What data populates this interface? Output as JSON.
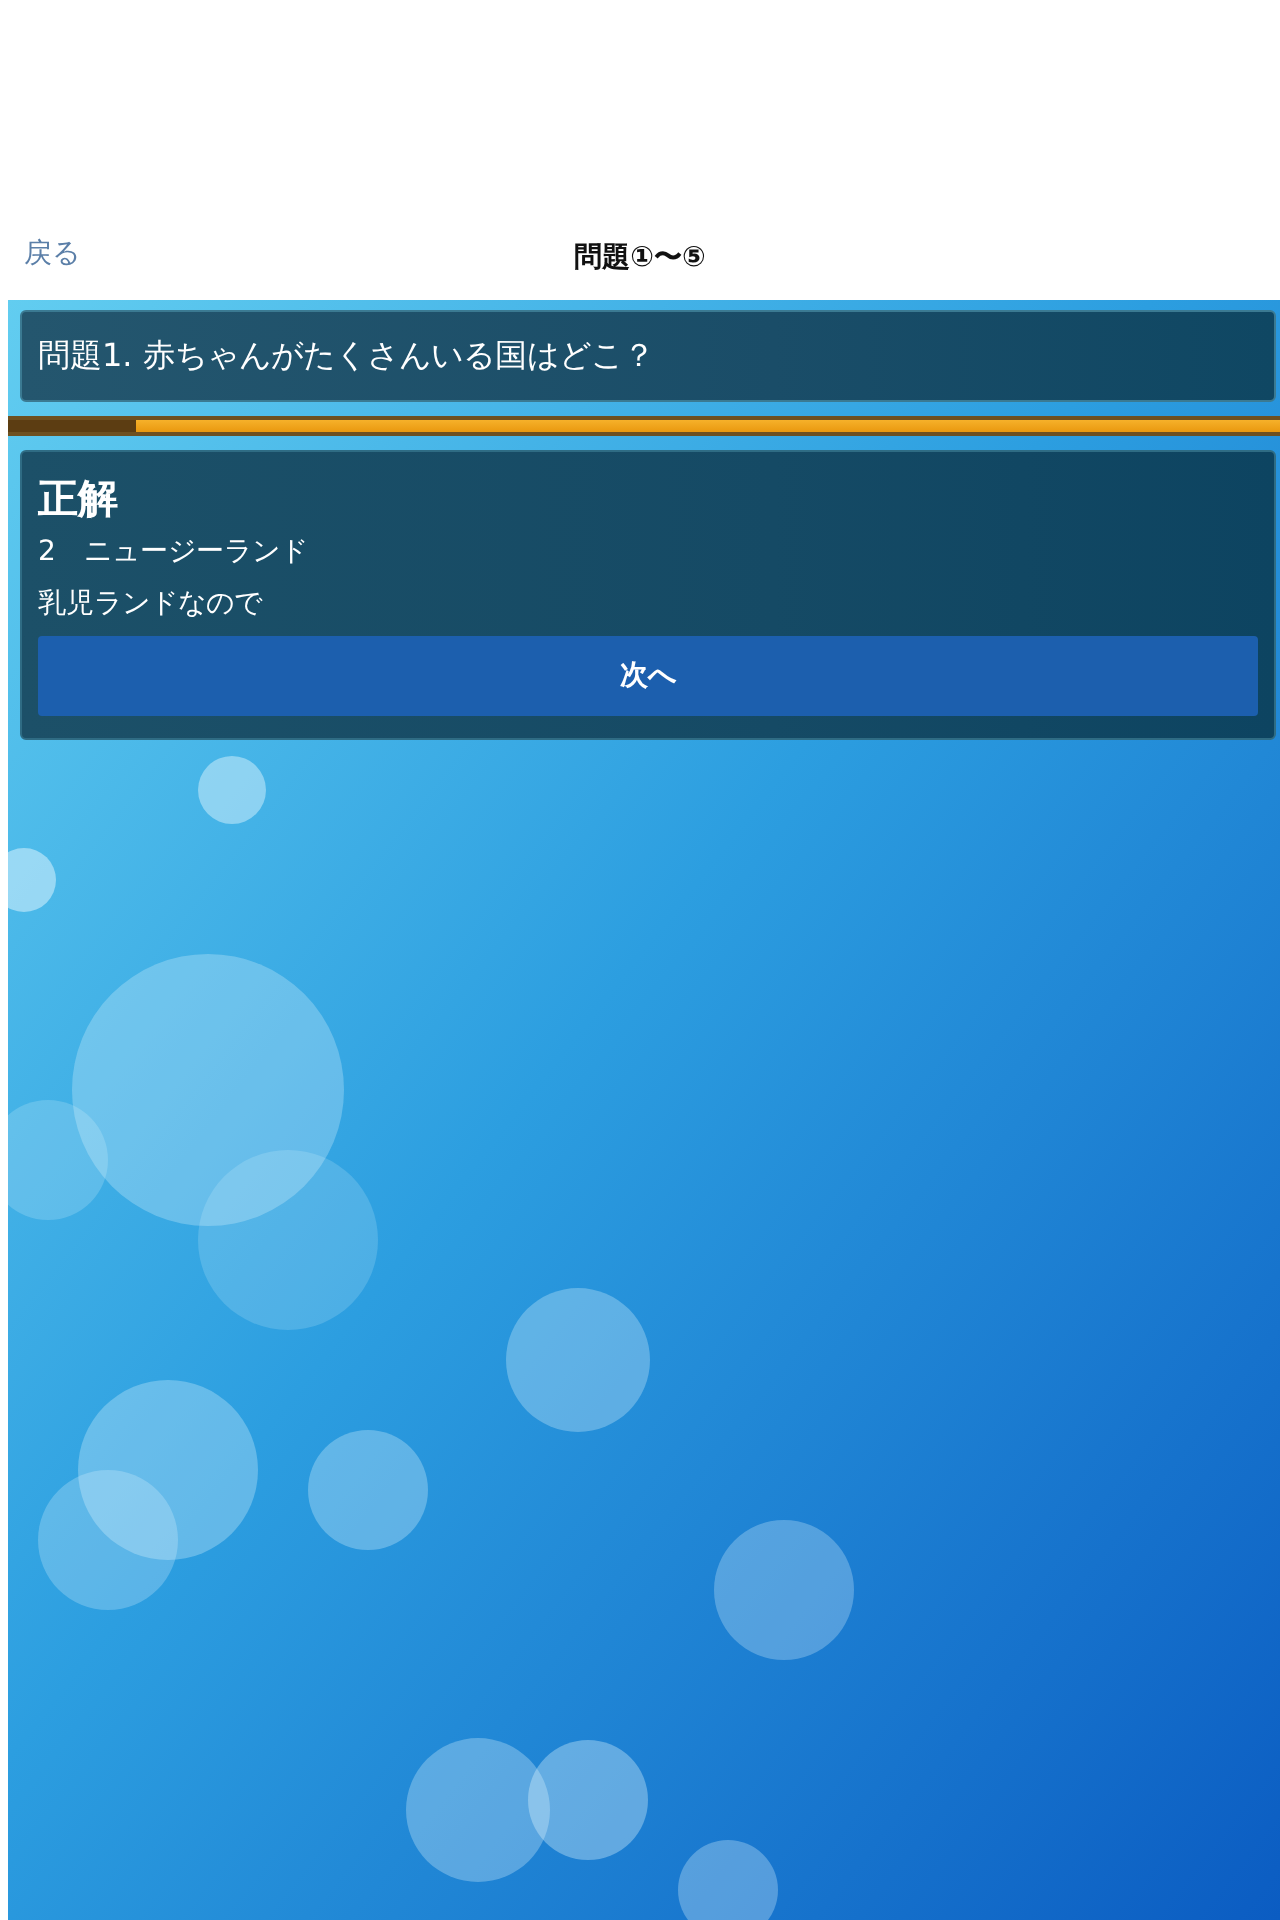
{
  "nav": {
    "back": "戻る",
    "title": "問題①〜⑤"
  },
  "question": {
    "text": "問題1. 赤ちゃんがたくさんいる国はどこ？"
  },
  "progress": {
    "level": 0.1
  },
  "result": {
    "verdict": "正解",
    "answer": "2　ニュージーランド",
    "explanation": "乳児ランドなので",
    "next_button": "次へ"
  }
}
